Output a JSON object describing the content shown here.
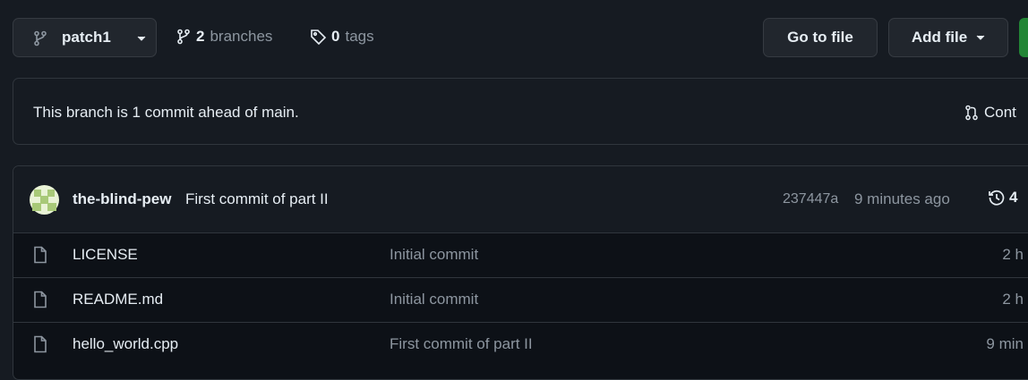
{
  "toolbar": {
    "branch_name": "patch1",
    "branch_count": "2",
    "branches_label": "branches",
    "tag_count": "0",
    "tags_label": "tags",
    "go_to_file_label": "Go to file",
    "add_file_label": "Add file"
  },
  "banner": {
    "text": "This branch is 1 commit ahead of main.",
    "contribute_label": "Cont"
  },
  "latest_commit": {
    "author": "the-blind-pew",
    "message": "First commit of part II",
    "sha": "237447a",
    "time": "9 minutes ago",
    "count": "4"
  },
  "files": [
    {
      "name": "LICENSE",
      "message": "Initial commit",
      "age": "2 h"
    },
    {
      "name": "README.md",
      "message": "Initial commit",
      "age": "2 h"
    },
    {
      "name": "hello_world.cpp",
      "message": "First commit of part II",
      "age": "9 min"
    }
  ],
  "colors": {
    "background": "#161b22",
    "border": "#30363d",
    "button": "#21262d",
    "muted_text": "#8d96a0",
    "primary_text": "#e6edf3",
    "code_button_green": "#238636"
  }
}
